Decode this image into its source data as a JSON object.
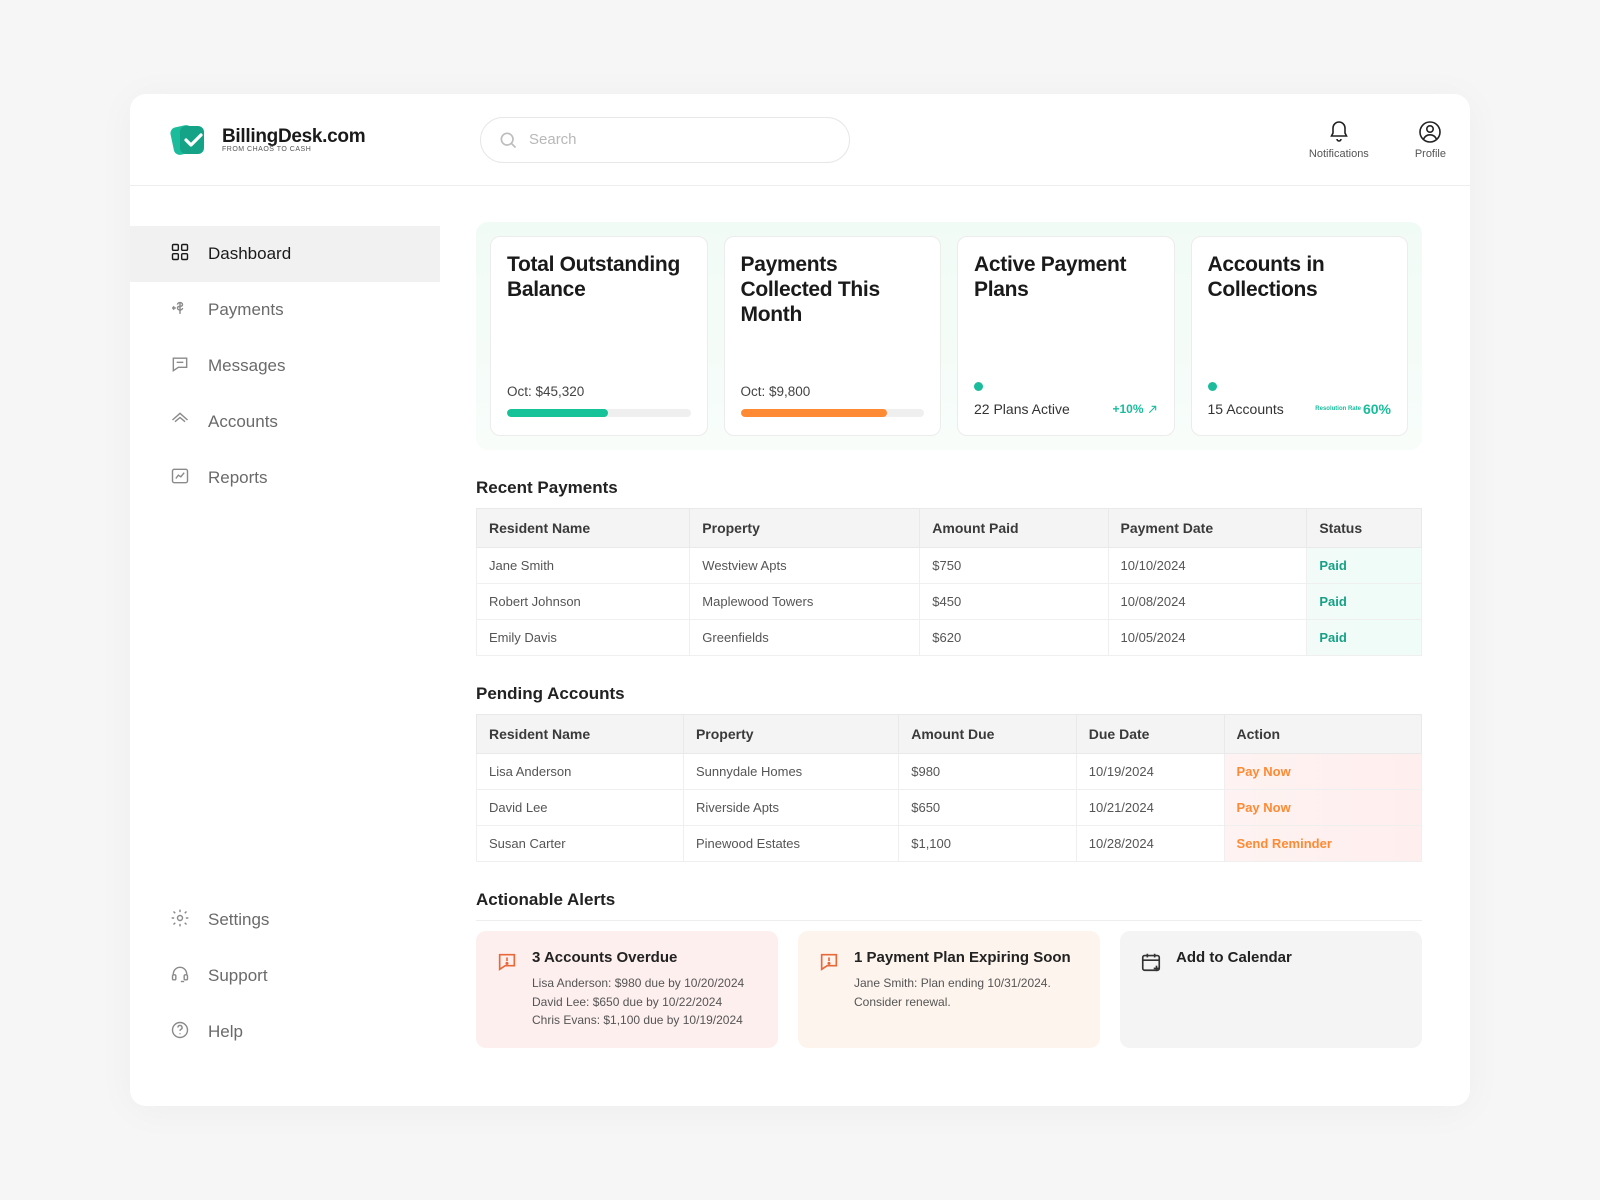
{
  "brand": {
    "name": "BillingDesk.com",
    "tagline": "FROM CHAOS TO CASH"
  },
  "search": {
    "placeholder": "Search"
  },
  "topbar": {
    "notifications_label": "Notifications",
    "profile_label": "Profile"
  },
  "nav": {
    "main": [
      {
        "label": "Dashboard",
        "icon": "grid",
        "active": true
      },
      {
        "label": "Payments",
        "icon": "dollar-arrow",
        "active": false
      },
      {
        "label": "Messages",
        "icon": "message",
        "active": false
      },
      {
        "label": "Accounts",
        "icon": "roof",
        "active": false
      },
      {
        "label": "Reports",
        "icon": "chart",
        "active": false
      }
    ],
    "footer": [
      {
        "label": "Settings",
        "icon": "gear"
      },
      {
        "label": "Support",
        "icon": "headset"
      },
      {
        "label": "Help",
        "icon": "question"
      }
    ]
  },
  "stats": {
    "outstanding": {
      "title": "Total Outstanding Balance",
      "sub": "Oct: $45,320",
      "progress_pct": 55,
      "bar_color": "#16c298"
    },
    "collected": {
      "title": "Payments Collected This Month",
      "sub": "Oct: $9,800",
      "progress_pct": 80,
      "bar_color": "#ff8a34"
    },
    "plans": {
      "title": "Active Payment Plans",
      "value": "22 Plans Active",
      "delta": "+10%"
    },
    "collections": {
      "title": "Accounts in Collections",
      "value": "15 Accounts",
      "mini_label": "Resolution Rate",
      "pct": "60%"
    }
  },
  "recent_title": "Recent Payments",
  "recent_cols": [
    "Resident Name",
    "Property",
    "Amount Paid",
    "Payment Date",
    "Status"
  ],
  "recent_rows": [
    {
      "name": "Jane Smith",
      "property": "Westview Apts",
      "amount": "$750",
      "date": "10/10/2024",
      "status": "Paid"
    },
    {
      "name": "Robert Johnson",
      "property": "Maplewood Towers",
      "amount": "$450",
      "date": "10/08/2024",
      "status": "Paid"
    },
    {
      "name": "Emily Davis",
      "property": "Greenfields",
      "amount": "$620",
      "date": "10/05/2024",
      "status": "Paid"
    }
  ],
  "pending_title": "Pending Accounts",
  "pending_cols": [
    "Resident Name",
    "Property",
    "Amount Due",
    "Due Date",
    "Action"
  ],
  "pending_rows": [
    {
      "name": "Lisa Anderson",
      "property": "Sunnydale Homes",
      "amount": "$980",
      "date": "10/19/2024",
      "action": "Pay Now"
    },
    {
      "name": "David Lee",
      "property": "Riverside Apts",
      "amount": "$650",
      "date": "10/21/2024",
      "action": "Pay Now"
    },
    {
      "name": "Susan Carter",
      "property": "Pinewood Estates",
      "amount": "$1,100",
      "date": "10/28/2024",
      "action": "Send Reminder"
    }
  ],
  "alerts_title": "Actionable Alerts",
  "alerts": {
    "overdue": {
      "title": "3 Accounts Overdue",
      "lines": [
        "Lisa Anderson: $980 due by 10/20/2024",
        "David Lee: $650 due by 10/22/2024",
        "Chris Evans: $1,100 due by 10/19/2024"
      ]
    },
    "expiring": {
      "title": "1 Payment Plan Expiring Soon",
      "lines": [
        "Jane Smith: Plan ending 10/31/2024.",
        "Consider renewal."
      ]
    },
    "calendar": {
      "title": "Add to Calendar"
    }
  }
}
